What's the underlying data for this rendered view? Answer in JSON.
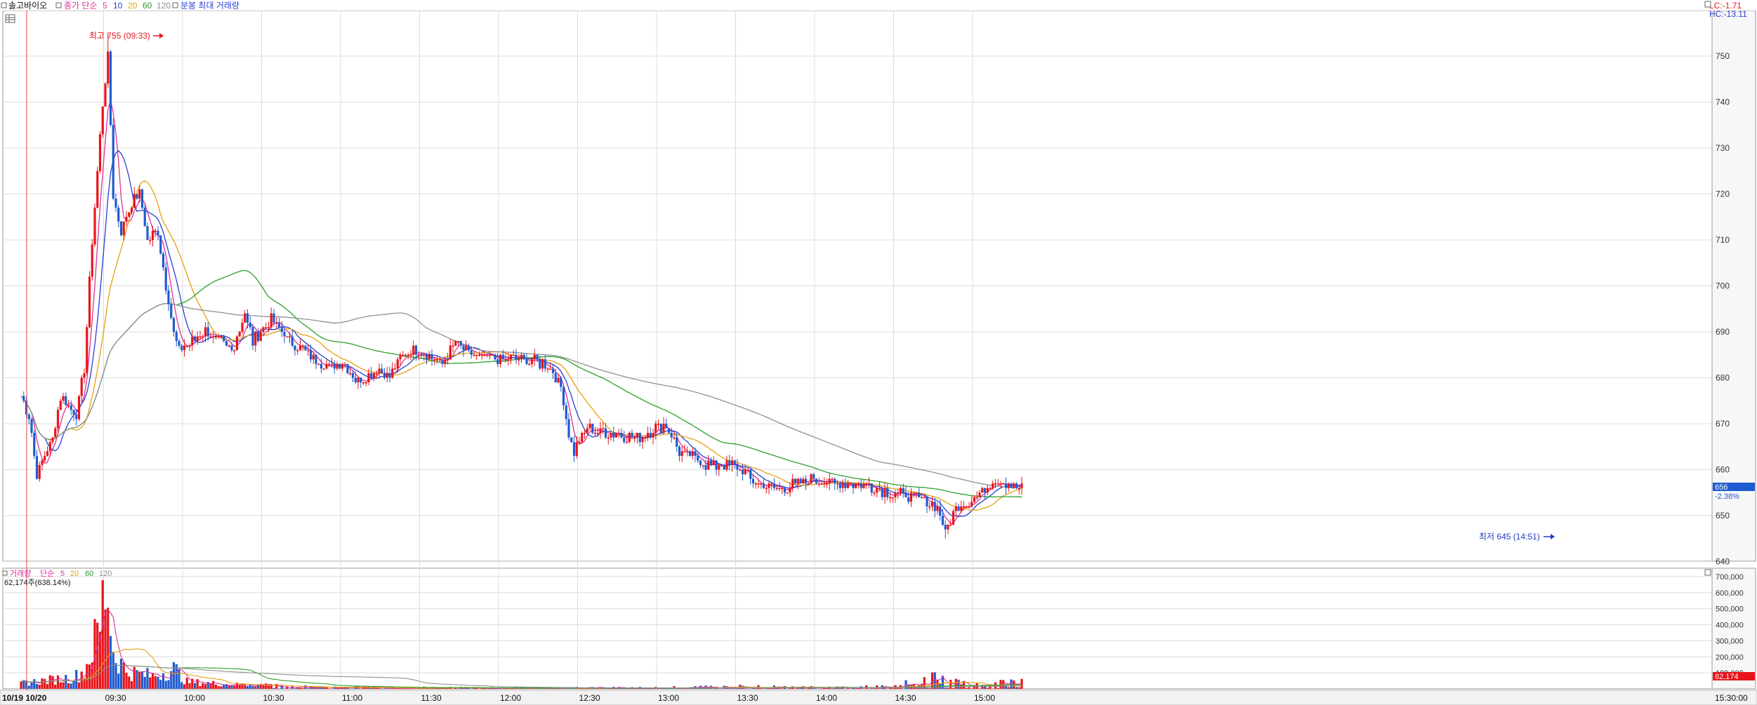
{
  "header": {
    "stock_name": "솔고바이오",
    "price_ma_label": "종가 단순",
    "ma_periods": [
      "5",
      "10",
      "20",
      "60",
      "120"
    ],
    "minute_label": "분봉 최대 거래량",
    "lc_label": "LC:-1.71",
    "hc_label": "HC:-13.11"
  },
  "volume_header": {
    "label": "거래량",
    "ma_label": "단순",
    "ma_periods": [
      "5",
      "20",
      "60",
      "120"
    ],
    "current": "62,174주(638.14%)"
  },
  "annotations": {
    "high": "최고 755 (09:33)",
    "low": "최저 645 (14:51)"
  },
  "price_axis": {
    "ticks": [
      "750",
      "740",
      "730",
      "720",
      "710",
      "700",
      "690",
      "680",
      "670",
      "660",
      "650",
      "640"
    ],
    "current_price": "656",
    "current_change": "-2.38%"
  },
  "volume_axis": {
    "ticks": [
      "700,000",
      "600,000",
      "500,000",
      "400,000",
      "300,000",
      "200,000",
      "100,000"
    ],
    "current_volume": "62,174"
  },
  "time_axis": {
    "date_label": "10/19 10/20",
    "ticks": [
      "09:30",
      "10:00",
      "10:30",
      "11:00",
      "11:30",
      "12:00",
      "12:30",
      "13:00",
      "13:30",
      "14:00",
      "14:30",
      "15:00"
    ],
    "end_label": "15:30:00"
  },
  "colors": {
    "up": "#e8141a",
    "down": "#1f5bd0",
    "ma5": "#e0309a",
    "ma10": "#2a3fd0",
    "ma20": "#e8a010",
    "ma60": "#2ca02c",
    "ma120": "#909090",
    "grid": "#dcdcdc",
    "axis_text": "#333333"
  },
  "chart_data": {
    "type": "candlestick",
    "title": "솔고바이오",
    "ylim": [
      638,
      758
    ],
    "interval": "1 minute",
    "high": {
      "value": 755,
      "time": "09:33"
    },
    "low": {
      "value": 645,
      "time": "14:51"
    },
    "last": {
      "price": 656,
      "change_pct": -2.38,
      "volume": 62174
    },
    "anchors": [
      [
        "09:00",
        676
      ],
      [
        "09:03",
        672
      ],
      [
        "09:06",
        659
      ],
      [
        "09:09",
        663
      ],
      [
        "09:12",
        667
      ],
      [
        "09:15",
        676
      ],
      [
        "09:18",
        674
      ],
      [
        "09:21",
        672
      ],
      [
        "09:24",
        682
      ],
      [
        "09:27",
        710
      ],
      [
        "09:29",
        725
      ],
      [
        "09:31",
        740
      ],
      [
        "09:33",
        750
      ],
      [
        "09:35",
        720
      ],
      [
        "09:38",
        712
      ],
      [
        "09:42",
        718
      ],
      [
        "09:45",
        720
      ],
      [
        "09:48",
        710
      ],
      [
        "09:52",
        712
      ],
      [
        "09:55",
        700
      ],
      [
        "09:58",
        690
      ],
      [
        "10:00",
        686
      ],
      [
        "10:05",
        688
      ],
      [
        "10:10",
        690
      ],
      [
        "10:15",
        688
      ],
      [
        "10:20",
        686
      ],
      [
        "10:25",
        694
      ],
      [
        "10:28",
        688
      ],
      [
        "10:35",
        693
      ],
      [
        "10:42",
        688
      ],
      [
        "10:50",
        685
      ],
      [
        "10:58",
        682
      ],
      [
        "11:02",
        684
      ],
      [
        "11:08",
        679
      ],
      [
        "11:15",
        682
      ],
      [
        "11:20",
        680
      ],
      [
        "11:25",
        685
      ],
      [
        "11:30",
        686
      ],
      [
        "11:40",
        683
      ],
      [
        "11:45",
        688
      ],
      [
        "11:50",
        685
      ],
      [
        "12:00",
        684
      ],
      [
        "12:10",
        684
      ],
      [
        "12:20",
        683
      ],
      [
        "12:25",
        678
      ],
      [
        "12:28",
        668
      ],
      [
        "12:30",
        664
      ],
      [
        "12:35",
        669
      ],
      [
        "12:45",
        668
      ],
      [
        "12:55",
        667
      ],
      [
        "13:00",
        669
      ],
      [
        "13:05",
        670
      ],
      [
        "13:10",
        664
      ],
      [
        "13:20",
        661
      ],
      [
        "13:30",
        661
      ],
      [
        "13:40",
        657
      ],
      [
        "13:50",
        656
      ],
      [
        "14:00",
        658
      ],
      [
        "14:10",
        657
      ],
      [
        "14:20",
        657
      ],
      [
        "14:30",
        655
      ],
      [
        "14:40",
        654
      ],
      [
        "14:48",
        652
      ],
      [
        "14:51",
        646
      ],
      [
        "14:55",
        652
      ],
      [
        "15:00",
        653
      ],
      [
        "15:05",
        655
      ],
      [
        "15:10",
        658
      ],
      [
        "15:15",
        657
      ],
      [
        "15:20",
        656
      ]
    ],
    "volume_anchors": [
      [
        "09:00",
        40000
      ],
      [
        "09:10",
        60000
      ],
      [
        "09:20",
        80000
      ],
      [
        "09:24",
        120000
      ],
      [
        "09:27",
        280000
      ],
      [
        "09:30",
        420000
      ],
      [
        "09:31",
        600000
      ],
      [
        "09:32",
        700000
      ],
      [
        "09:33",
        680000
      ],
      [
        "09:35",
        260000
      ],
      [
        "09:40",
        120000
      ],
      [
        "09:50",
        90000
      ],
      [
        "09:58",
        140000
      ],
      [
        "10:03",
        50000
      ],
      [
        "10:20",
        30000
      ],
      [
        "10:30",
        30000
      ],
      [
        "11:00",
        12000
      ],
      [
        "12:00",
        8000
      ],
      [
        "13:00",
        10000
      ],
      [
        "13:30",
        20000
      ],
      [
        "14:00",
        15000
      ],
      [
        "14:30",
        20000
      ],
      [
        "14:51",
        90000
      ],
      [
        "15:00",
        20000
      ],
      [
        "15:20",
        62174
      ]
    ],
    "ma_periods": [
      5,
      10,
      20,
      60,
      120
    ],
    "volume_ma_periods": [
      5,
      20,
      60,
      120
    ]
  }
}
